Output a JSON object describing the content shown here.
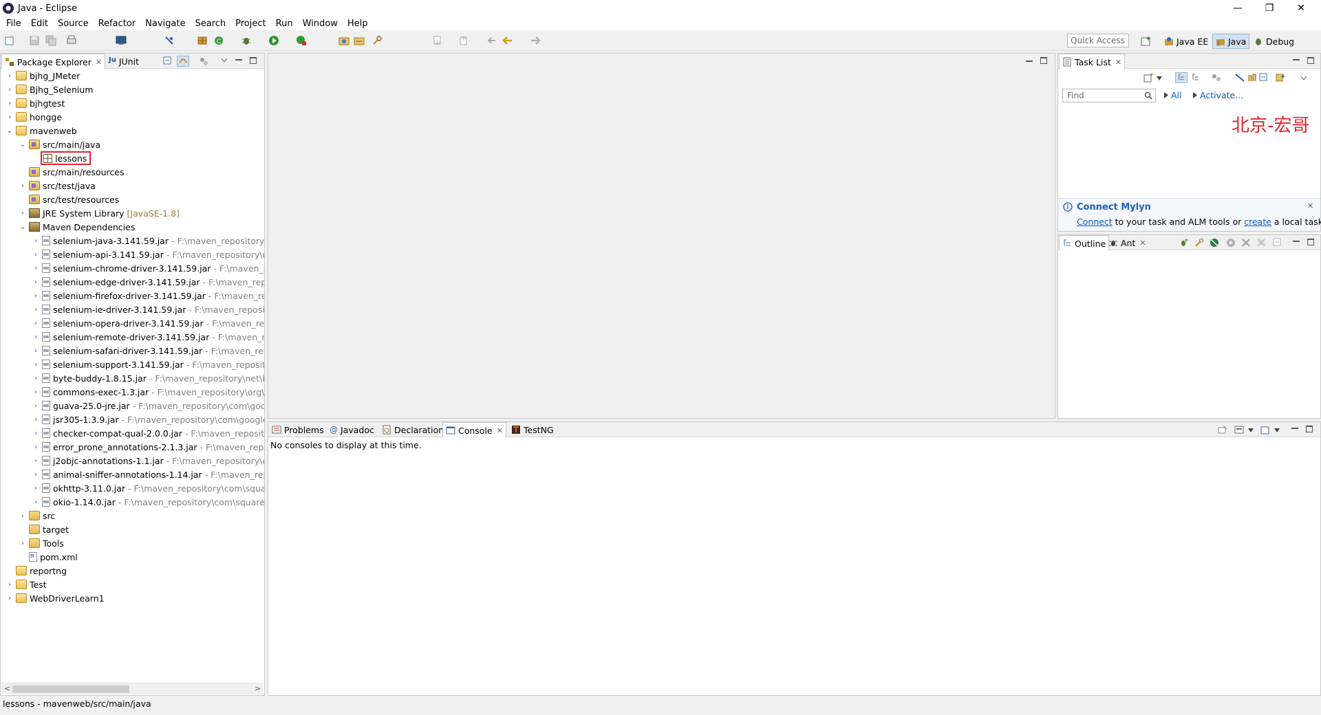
{
  "window": {
    "title": "Java - Eclipse",
    "controls": [
      "—",
      "❐",
      "✕"
    ]
  },
  "menu": [
    "File",
    "Edit",
    "Source",
    "Refactor",
    "Navigate",
    "Search",
    "Project",
    "Run",
    "Window",
    "Help"
  ],
  "toolbar": {
    "quick_access_placeholder": "Quick Access",
    "perspectives": [
      "Java EE",
      "Java",
      "Debug"
    ],
    "active_perspective": "Java"
  },
  "package_explorer": {
    "tabs": [
      "Package Explorer",
      "JUnit"
    ],
    "tree": [
      {
        "label": "bjhg_JMeter",
        "indent": 0,
        "twisty": ">",
        "icon": "project"
      },
      {
        "label": "Bjhg_Selenium",
        "indent": 0,
        "twisty": ">",
        "icon": "project"
      },
      {
        "label": "bjhgtest",
        "indent": 0,
        "twisty": ">",
        "icon": "project"
      },
      {
        "label": "hongge",
        "indent": 0,
        "twisty": ">",
        "icon": "project"
      },
      {
        "label": "mavenweb",
        "indent": 0,
        "twisty": "v",
        "icon": "project"
      },
      {
        "label": "src/main/java",
        "indent": 1,
        "twisty": "v",
        "icon": "srcfolder"
      },
      {
        "label": "lessons",
        "indent": 2,
        "twisty": "",
        "icon": "pkg",
        "selected": true
      },
      {
        "label": "src/main/resources",
        "indent": 1,
        "twisty": "",
        "icon": "srcfolder"
      },
      {
        "label": "src/test/java",
        "indent": 1,
        "twisty": ">",
        "icon": "srcfolder"
      },
      {
        "label": "src/test/resources",
        "indent": 1,
        "twisty": "",
        "icon": "srcfolder"
      },
      {
        "label": "JRE System Library",
        "suffix": "[JavaSE-1.8]",
        "indent": 1,
        "twisty": ">",
        "icon": "lib"
      },
      {
        "label": "Maven Dependencies",
        "indent": 1,
        "twisty": "v",
        "icon": "lib"
      },
      {
        "label": "selenium-java-3.141.59.jar",
        "path": "- F:\\maven_repository\\or",
        "indent": 2,
        "twisty": ">",
        "icon": "jar"
      },
      {
        "label": "selenium-api-3.141.59.jar",
        "path": "- F:\\maven_repository\\org",
        "indent": 2,
        "twisty": ">",
        "icon": "jar"
      },
      {
        "label": "selenium-chrome-driver-3.141.59.jar",
        "path": "- F:\\maven_rep",
        "indent": 2,
        "twisty": ">",
        "icon": "jar"
      },
      {
        "label": "selenium-edge-driver-3.141.59.jar",
        "path": "- F:\\maven_repos",
        "indent": 2,
        "twisty": ">",
        "icon": "jar"
      },
      {
        "label": "selenium-firefox-driver-3.141.59.jar",
        "path": "- F:\\maven_repo",
        "indent": 2,
        "twisty": ">",
        "icon": "jar"
      },
      {
        "label": "selenium-ie-driver-3.141.59.jar",
        "path": "- F:\\maven_reposito",
        "indent": 2,
        "twisty": ">",
        "icon": "jar"
      },
      {
        "label": "selenium-opera-driver-3.141.59.jar",
        "path": "- F:\\maven_repo",
        "indent": 2,
        "twisty": ">",
        "icon": "jar"
      },
      {
        "label": "selenium-remote-driver-3.141.59.jar",
        "path": "- F:\\maven_rep",
        "indent": 2,
        "twisty": ">",
        "icon": "jar"
      },
      {
        "label": "selenium-safari-driver-3.141.59.jar",
        "path": "- F:\\maven_repo",
        "indent": 2,
        "twisty": ">",
        "icon": "jar"
      },
      {
        "label": "selenium-support-3.141.59.jar",
        "path": "- F:\\maven_reposito",
        "indent": 2,
        "twisty": ">",
        "icon": "jar"
      },
      {
        "label": "byte-buddy-1.8.15.jar",
        "path": "- F:\\maven_repository\\net\\byt",
        "indent": 2,
        "twisty": ">",
        "icon": "jar"
      },
      {
        "label": "commons-exec-1.3.jar",
        "path": "- F:\\maven_repository\\org\\a",
        "indent": 2,
        "twisty": ">",
        "icon": "jar"
      },
      {
        "label": "guava-25.0-jre.jar",
        "path": "- F:\\maven_repository\\com\\goog",
        "indent": 2,
        "twisty": ">",
        "icon": "jar"
      },
      {
        "label": "jsr305-1.3.9.jar",
        "path": "- F:\\maven_repository\\com\\google\\",
        "indent": 2,
        "twisty": ">",
        "icon": "jar"
      },
      {
        "label": "checker-compat-qual-2.0.0.jar",
        "path": "- F:\\maven_reposito",
        "indent": 2,
        "twisty": ">",
        "icon": "jar"
      },
      {
        "label": "error_prone_annotations-2.1.3.jar",
        "path": "- F:\\maven_repos",
        "indent": 2,
        "twisty": ">",
        "icon": "jar"
      },
      {
        "label": "j2objc-annotations-1.1.jar",
        "path": "- F:\\maven_repository\\co",
        "indent": 2,
        "twisty": ">",
        "icon": "jar"
      },
      {
        "label": "animal-sniffer-annotations-1.14.jar",
        "path": "- F:\\maven_repo",
        "indent": 2,
        "twisty": ">",
        "icon": "jar"
      },
      {
        "label": "okhttp-3.11.0.jar",
        "path": "- F:\\maven_repository\\com\\square",
        "indent": 2,
        "twisty": ">",
        "icon": "jar"
      },
      {
        "label": "okio-1.14.0.jar",
        "path": "- F:\\maven_repository\\com\\squareu",
        "indent": 2,
        "twisty": ">",
        "icon": "jar"
      },
      {
        "label": "src",
        "indent": 1,
        "twisty": ">",
        "icon": "folder"
      },
      {
        "label": "target",
        "indent": 1,
        "twisty": "",
        "icon": "folder"
      },
      {
        "label": "Tools",
        "indent": 1,
        "twisty": ">",
        "icon": "folder"
      },
      {
        "label": "pom.xml",
        "indent": 1,
        "twisty": "",
        "icon": "xml"
      },
      {
        "label": "reportng",
        "indent": 0,
        "twisty": "",
        "icon": "project"
      },
      {
        "label": "Test",
        "indent": 0,
        "twisty": ">",
        "icon": "project"
      },
      {
        "label": "WebDriverLearn1",
        "indent": 0,
        "twisty": ">",
        "icon": "project"
      }
    ]
  },
  "task_list": {
    "tab": "Task List",
    "find_placeholder": "Find",
    "all_label": "All",
    "activate_label": "Activate...",
    "watermark": "北京-宏哥",
    "mylyn_title": "Connect Mylyn",
    "mylyn_connect": "Connect",
    "mylyn_mid": " to your task and ALM tools or ",
    "mylyn_create": "create",
    "mylyn_end": " a local task."
  },
  "outline": {
    "tabs": [
      "Outline",
      "Ant"
    ]
  },
  "bottom": {
    "tabs": [
      "Problems",
      "Javadoc",
      "Declaration",
      "Console",
      "TestNG"
    ],
    "active_tab": "Console",
    "console_message": "No consoles to display at this time."
  },
  "status": {
    "text": "lessons - mavenweb/src/main/java"
  },
  "colors": {
    "accent": "#0b57c5",
    "highlight_box": "#e3232e"
  }
}
